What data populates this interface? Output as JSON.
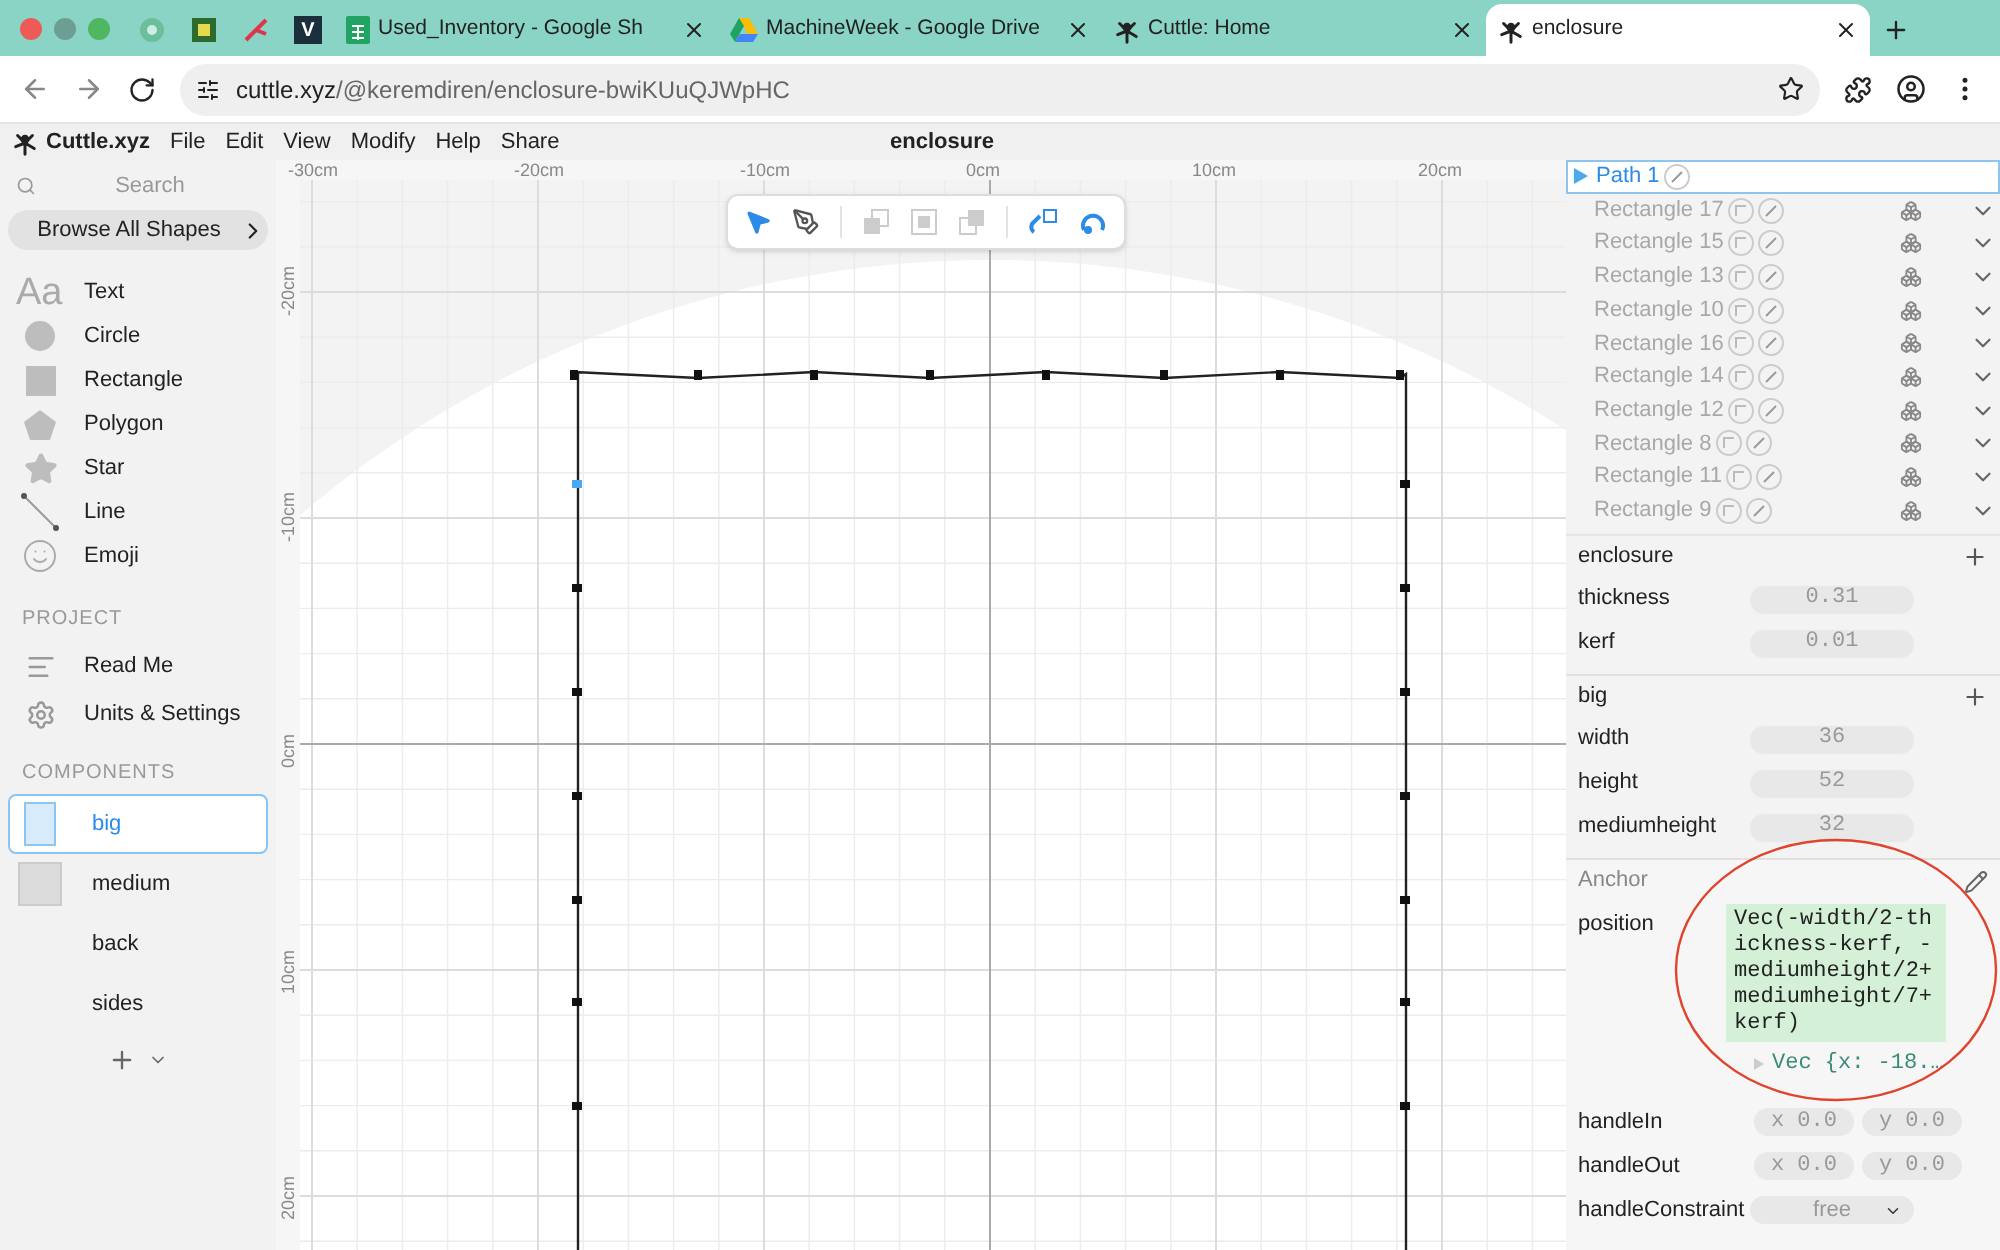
{
  "browser": {
    "tabs": [
      {
        "kind": "pinned",
        "selected": false
      },
      {
        "kind": "pinned",
        "selected": false
      },
      {
        "kind": "pinned",
        "selected": false
      },
      {
        "kind": "pinned",
        "label": "V",
        "selected": false
      },
      {
        "kind": "full",
        "label": "Used_Inventory - Google Sh",
        "selected": false
      },
      {
        "kind": "full",
        "label": "MachineWeek - Google Drive",
        "selected": false
      },
      {
        "kind": "full",
        "label": "Cuttle: Home",
        "selected": false
      },
      {
        "kind": "full",
        "label": "enclosure",
        "selected": true
      }
    ],
    "url_host": "cuttle.xyz",
    "url_path": "/@keremdiren/enclosure-bwiKUuQJWpHC"
  },
  "app": {
    "logo": "Cuttle.xyz",
    "menu": [
      "File",
      "Edit",
      "View",
      "Modify",
      "Help",
      "Share"
    ],
    "title": "enclosure"
  },
  "sidebar": {
    "search": {
      "placeholder": "Search"
    },
    "browse": "Browse All Shapes",
    "shapes": [
      {
        "kind": "text",
        "glyph": "Aa",
        "label": "Text"
      },
      {
        "kind": "circle",
        "label": "Circle"
      },
      {
        "kind": "rectangle",
        "label": "Rectangle"
      },
      {
        "kind": "polygon",
        "label": "Polygon"
      },
      {
        "kind": "star",
        "label": "Star"
      },
      {
        "kind": "line",
        "label": "Line"
      },
      {
        "kind": "emoji",
        "label": "Emoji"
      }
    ],
    "project_heading": "PROJECT",
    "project": [
      {
        "kind": "readme",
        "label": "Read Me"
      },
      {
        "kind": "settings",
        "label": "Units & Settings"
      }
    ],
    "components_heading": "COMPONENTS",
    "components": [
      {
        "kind": "outline",
        "label": "big",
        "selected": true
      },
      {
        "kind": "filled",
        "label": "medium",
        "selected": false
      },
      {
        "kind": "plain",
        "label": "back",
        "selected": false
      },
      {
        "kind": "plain",
        "label": "sides",
        "selected": false
      }
    ]
  },
  "canvas": {
    "x_ruler": [
      "-30cm",
      "-20cm",
      "-10cm",
      "0cm",
      "10cm",
      "20cm"
    ],
    "y_ruler": [
      "-20cm",
      "-10cm",
      "0cm",
      "10cm",
      "20cm"
    ]
  },
  "layers": [
    {
      "label": "Path 1",
      "selected": true,
      "expandable": true
    },
    {
      "label": "Rectangle 17",
      "selected": false,
      "expandable": false
    },
    {
      "label": "Rectangle 15",
      "selected": false,
      "expandable": false
    },
    {
      "label": "Rectangle 13",
      "selected": false,
      "expandable": false
    },
    {
      "label": "Rectangle 10",
      "selected": false,
      "expandable": false
    },
    {
      "label": "Rectangle 16",
      "selected": false,
      "expandable": false
    },
    {
      "label": "Rectangle 14",
      "selected": false,
      "expandable": false
    },
    {
      "label": "Rectangle 12",
      "selected": false,
      "expandable": false
    },
    {
      "label": "Rectangle 8",
      "selected": false,
      "expandable": false
    },
    {
      "label": "Rectangle 11",
      "selected": false,
      "expandable": false
    },
    {
      "label": "Rectangle 9",
      "selected": false,
      "expandable": false
    }
  ],
  "parameter_groups": [
    {
      "name": "enclosure",
      "params": [
        {
          "name": "thickness",
          "value": "0.31"
        },
        {
          "name": "kerf",
          "value": "0.01"
        }
      ]
    },
    {
      "name": "big",
      "params": [
        {
          "name": "width",
          "value": "36"
        },
        {
          "name": "height",
          "value": "52"
        },
        {
          "name": "mediumheight",
          "value": "32"
        }
      ]
    }
  ],
  "anchor": {
    "heading": "Anchor",
    "position_label": "position",
    "position_expression": "Vec(-width/2-thickness-kerf, -mediumheight/2+mediumheight/7+kerf)",
    "position_result": "Vec {x: -18.…",
    "handles": [
      {
        "label": "handleIn",
        "x": "x 0.0",
        "y": "y 0.0"
      },
      {
        "label": "handleOut",
        "x": "x 0.0",
        "y": "y 0.0"
      }
    ],
    "constraint_label": "handleConstraint",
    "constraint_value": "free"
  }
}
